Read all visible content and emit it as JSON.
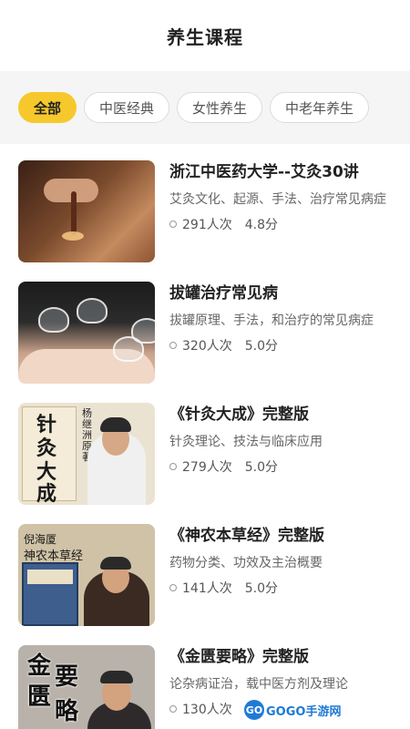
{
  "header": {
    "title": "养生课程"
  },
  "filters": [
    {
      "label": "全部",
      "active": true
    },
    {
      "label": "中医经典",
      "active": false
    },
    {
      "label": "女性养生",
      "active": false
    },
    {
      "label": "中老年养生",
      "active": false
    }
  ],
  "courses": [
    {
      "title": "浙江中医药大学--艾灸30讲",
      "desc": "艾灸文化、起源、手法、治疗常见病症",
      "views": "291人次",
      "score": "4.8分"
    },
    {
      "title": "拔罐治疗常见病",
      "desc": "拔罐原理、手法，和治疗的常见病症",
      "views": "320人次",
      "score": "5.0分"
    },
    {
      "title": "《针灸大成》完整版",
      "desc": "针灸理论、技法与临床应用",
      "views": "279人次",
      "score": "5.0分",
      "thumb_text": {
        "big": [
          "针",
          "灸",
          "大",
          "成"
        ],
        "small": "杨继洲原著"
      }
    },
    {
      "title": "《神农本草经》完整版",
      "desc": "药物分类、功效及主治概要",
      "views": "141人次",
      "score": "5.0分",
      "thumb_text": {
        "author": "倪海厦",
        "book": "神农本草经"
      }
    },
    {
      "title": "《金匮要略》完整版",
      "desc": "论杂病证治，载中医方剂及理论",
      "views": "130人次",
      "score": "",
      "thumb_text": {
        "chars": [
          "金",
          "要",
          "匮",
          "略"
        ]
      }
    }
  ],
  "watermark": {
    "logo": "GO",
    "text": "GOGO手游网"
  },
  "colors": {
    "accent": "#f7c82b",
    "filter_bg": "#f5f5f5"
  }
}
